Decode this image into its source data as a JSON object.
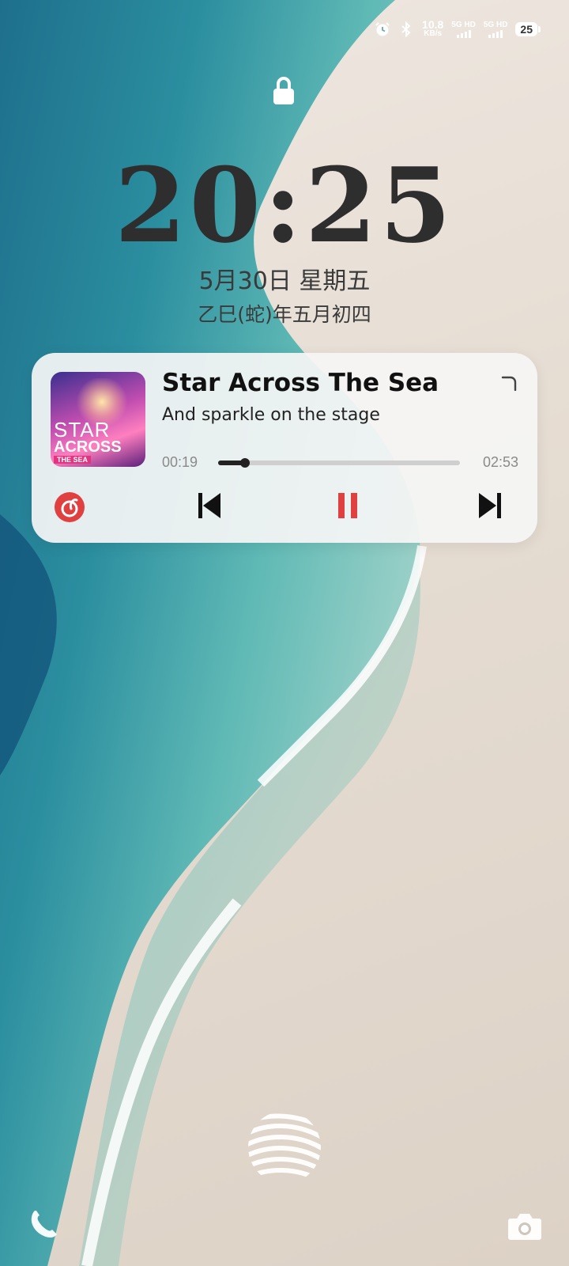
{
  "status_bar": {
    "net_speed_value": "10.8",
    "net_speed_unit": "KB/s",
    "sim1_label": "5G HD",
    "sim2_label": "5G HD",
    "battery_level": "25",
    "icons": [
      "alarm-icon",
      "bluetooth-icon"
    ]
  },
  "lock": {
    "icon": "lock-icon"
  },
  "clock": {
    "time": "20:25",
    "date": "5月30日 星期五",
    "lunar_date": "乙巳(蛇)年五月初四"
  },
  "media": {
    "album_art_text": [
      "STAR",
      "ACROSS",
      "THE SEA"
    ],
    "title": "Star Across The Sea",
    "lyric": "And sparkle on the stage",
    "elapsed": "00:19",
    "duration": "02:53",
    "progress_fraction": 0.11,
    "state": "playing",
    "app_icon": "netease-music-icon",
    "controls": [
      "previous-icon",
      "pause-icon",
      "next-icon"
    ],
    "accent": "#e0403f"
  },
  "bottom": {
    "left_shortcut": "phone-icon",
    "right_shortcut": "camera-icon",
    "center": "fingerprint-icon"
  },
  "colors": {
    "text_primary": "#2e2e2e",
    "card_bg": "#f5f5f5",
    "sea": "#3aa3ad",
    "sand": "#e6ddd3"
  }
}
